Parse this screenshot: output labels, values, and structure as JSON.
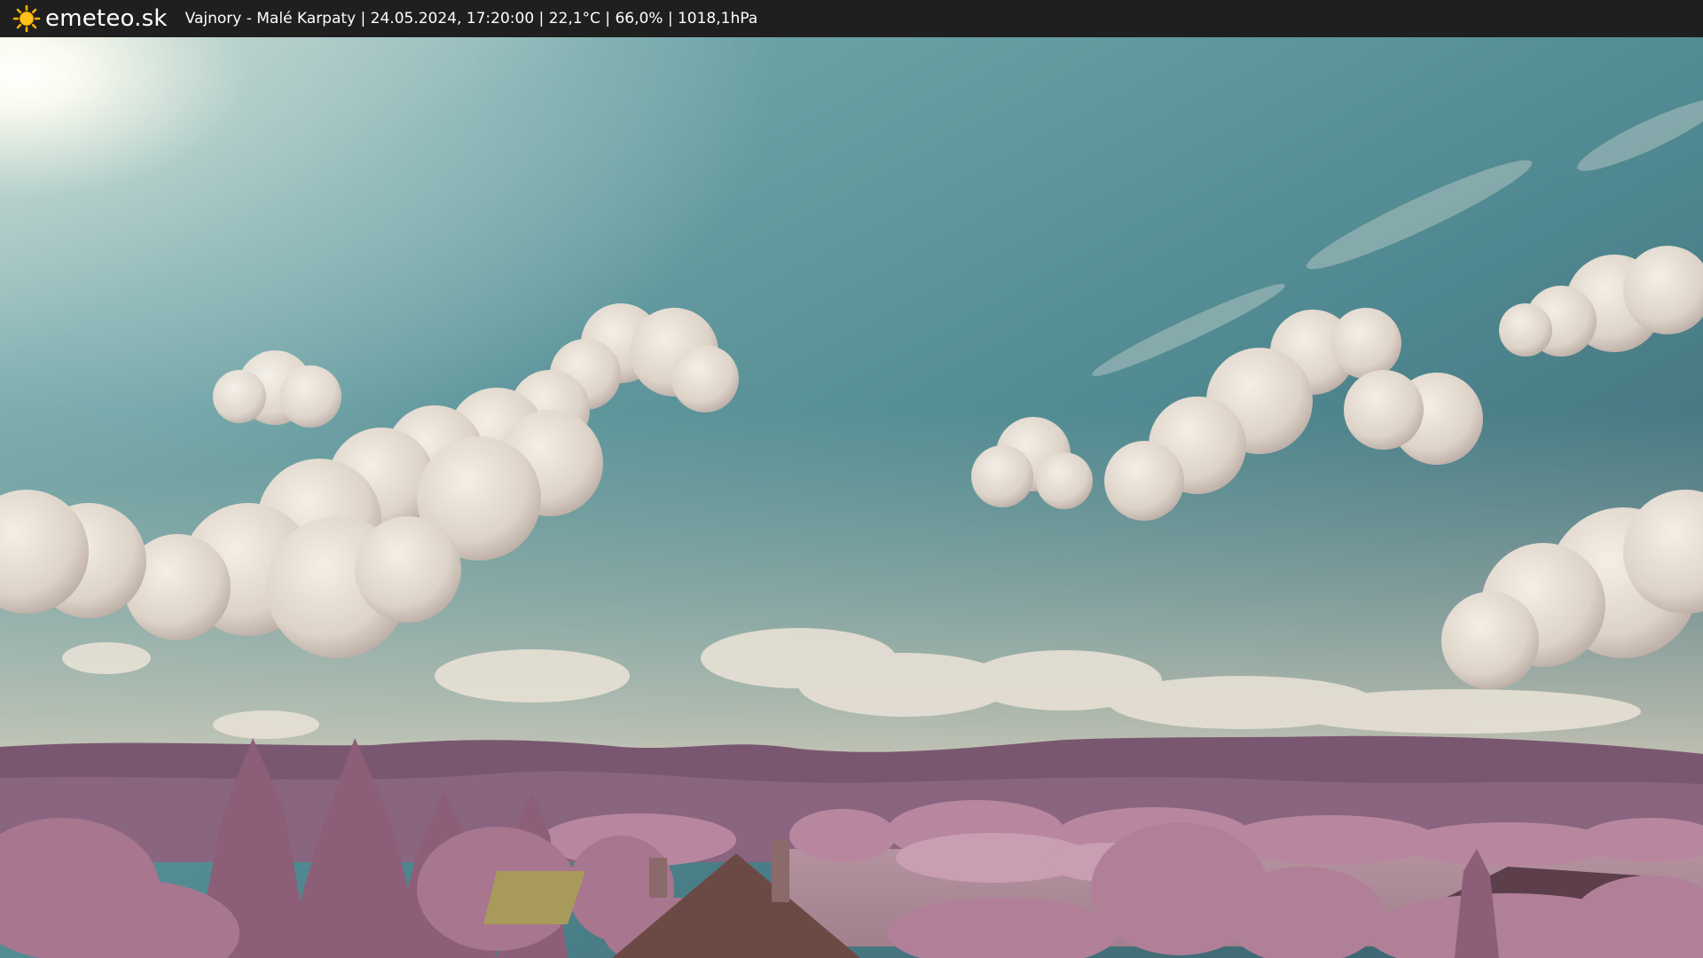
{
  "header": {
    "brand": "emeteo.sk",
    "caption": "Vajnory - Malé Karpaty | 24.05.2024, 17:20:00 | 22,1°C | 66,0% | 1018,1hPa"
  },
  "icons": {
    "logo": "sun-icon"
  },
  "colors": {
    "topbar": "#1f1f1f",
    "sky_top": "#3f6a77",
    "sky_mid": "#5f9aa0",
    "cloud": "#e8e1d8",
    "foliage": "#a57a92",
    "hills": "#6e4e63"
  }
}
